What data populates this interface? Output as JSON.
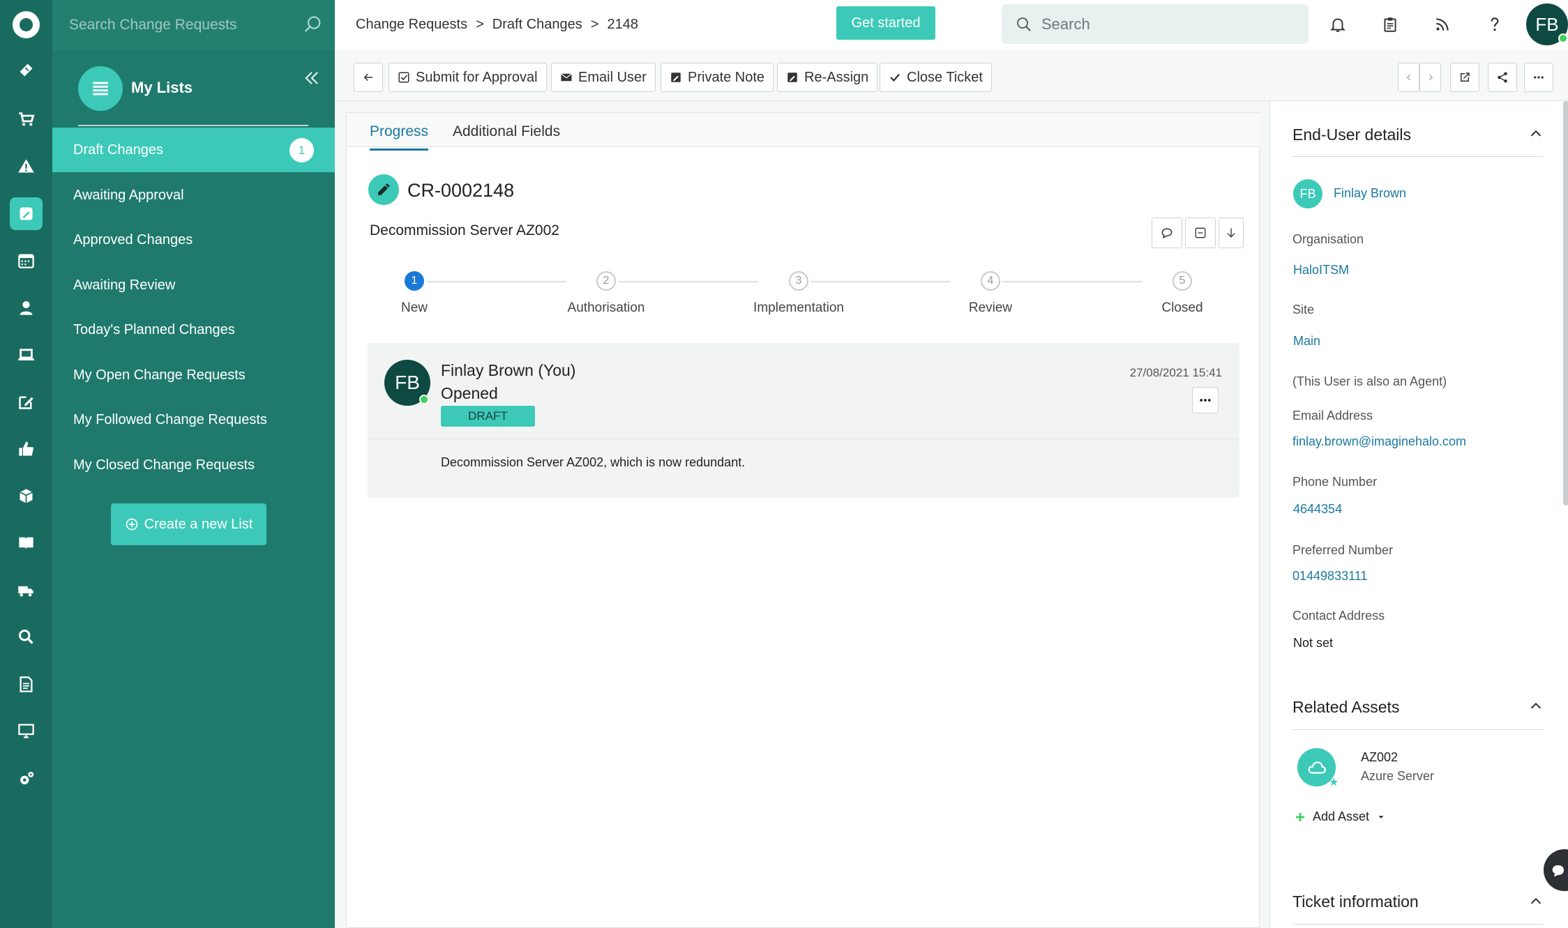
{
  "sidebar": {
    "search_placeholder": "Search Change Requests",
    "my_lists_title": "My Lists",
    "items": [
      {
        "label": "Draft Changes",
        "count": "1"
      },
      {
        "label": "Awaiting Approval"
      },
      {
        "label": "Approved Changes"
      },
      {
        "label": "Awaiting Review"
      },
      {
        "label": "Today's Planned Changes"
      },
      {
        "label": "My Open Change Requests"
      },
      {
        "label": "My Followed Change Requests"
      },
      {
        "label": "My Closed Change Requests"
      }
    ],
    "create_list_label": "Create a new List"
  },
  "rail": {
    "icons": [
      "home-logo",
      "tickets-icon",
      "cart-icon",
      "alert-icon",
      "changes-icon",
      "calendar-icon",
      "user-icon",
      "laptop-icon",
      "edit-icon",
      "thumbs-up-icon",
      "packages-icon",
      "book-icon",
      "truck-icon",
      "search-icon",
      "document-icon",
      "monitor-icon",
      "settings-icon"
    ],
    "active": "changes-icon"
  },
  "header": {
    "breadcrumb": [
      "Change Requests",
      ">",
      "Draft Changes",
      ">",
      "2148"
    ],
    "get_started": "Get started",
    "search_placeholder": "Search",
    "user_initials": "FB"
  },
  "toolbar": {
    "buttons": [
      "Submit for Approval",
      "Email User",
      "Private Note",
      "Re-Assign",
      "Close Ticket"
    ]
  },
  "tabs": [
    "Progress",
    "Additional Fields"
  ],
  "ticket": {
    "id": "CR-0002148",
    "summary": "Decommission Server AZ002",
    "steps": [
      {
        "num": "1",
        "label": "New",
        "active": true
      },
      {
        "num": "2",
        "label": "Authorisation"
      },
      {
        "num": "3",
        "label": "Implementation"
      },
      {
        "num": "4",
        "label": "Review"
      },
      {
        "num": "5",
        "label": "Closed"
      }
    ],
    "action": {
      "initials": "FB",
      "name": "Finlay Brown (You)",
      "type": "Opened",
      "status": "DRAFT",
      "timestamp": "27/08/2021 15:41",
      "note": "Decommission Server AZ002, which is now redundant."
    }
  },
  "end_user": {
    "title": "End-User details",
    "initials": "FB",
    "name": "Finlay Brown",
    "organisation_label": "Organisation",
    "organisation": "HaloITSM",
    "site_label": "Site",
    "site": "Main",
    "agent_note": "(This User is also an Agent)",
    "email_label": "Email Address",
    "email": "finlay.brown@imaginehalo.com",
    "phone_label": "Phone Number",
    "phone": "4644354",
    "preferred_label": "Preferred Number",
    "preferred": "01449833111",
    "address_label": "Contact Address",
    "address": "Not set"
  },
  "related_assets": {
    "title": "Related Assets",
    "asset_name": "AZ002",
    "asset_type": "Azure Server",
    "add_label": "Add Asset"
  },
  "ticket_information": {
    "title": "Ticket information"
  },
  "colors": {
    "rail": "#1a6b5f",
    "panel": "#1f7a6d",
    "accent": "#3cc9b8",
    "link": "#1b79a0"
  }
}
